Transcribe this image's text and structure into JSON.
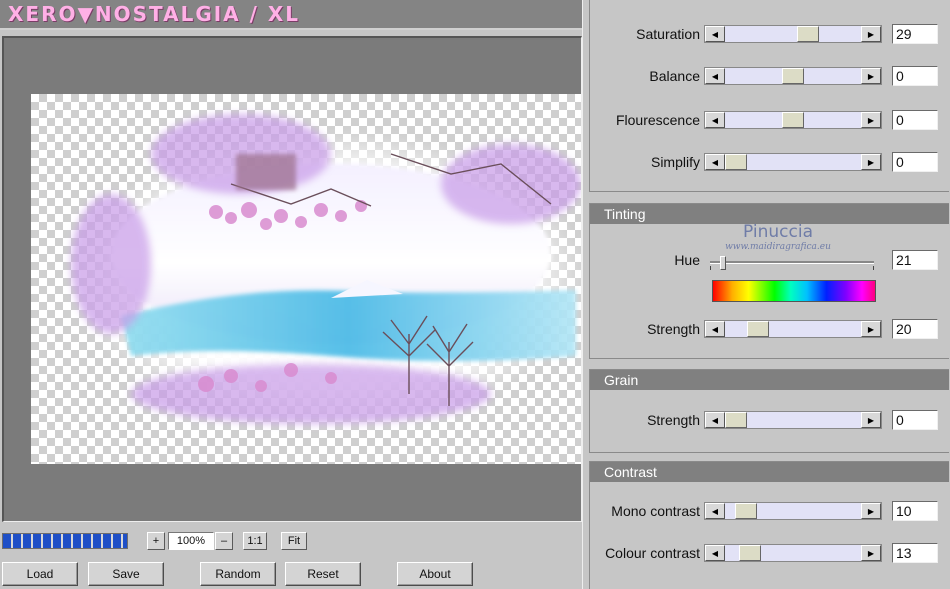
{
  "app": {
    "title": "XERO▼NOSTALGIA / XL"
  },
  "zoom": {
    "in_label": "+",
    "value": "100%",
    "out_label": "–",
    "one_to_one_label": "1:1",
    "fit_label": "Fit"
  },
  "progress": {
    "percent": 100
  },
  "buttons": {
    "load": "Load",
    "save": "Save",
    "random": "Random",
    "reset": "Reset",
    "about": "About"
  },
  "sliders_top": [
    {
      "label": "Saturation",
      "value": "29"
    },
    {
      "label": "Balance",
      "value": "0"
    },
    {
      "label": "Flourescence",
      "value": "0"
    },
    {
      "label": "Simplify",
      "value": "0"
    }
  ],
  "tinting": {
    "header": "Tinting",
    "hue_label": "Hue",
    "hue_value": "21",
    "strength_label": "Strength",
    "strength_value": "20",
    "watermark_name": "Pinuccia",
    "watermark_site": "www.maidiragrafica.eu"
  },
  "grain": {
    "header": "Grain",
    "strength_label": "Strength",
    "strength_value": "0"
  },
  "contrast": {
    "header": "Contrast",
    "mono_label": "Mono contrast",
    "mono_value": "10",
    "colour_label": "Colour contrast",
    "colour_value": "13"
  },
  "colors": {
    "title": "#ffb0e6",
    "progress": "#1e4fc7",
    "slider_track": "#e2e2f6"
  }
}
